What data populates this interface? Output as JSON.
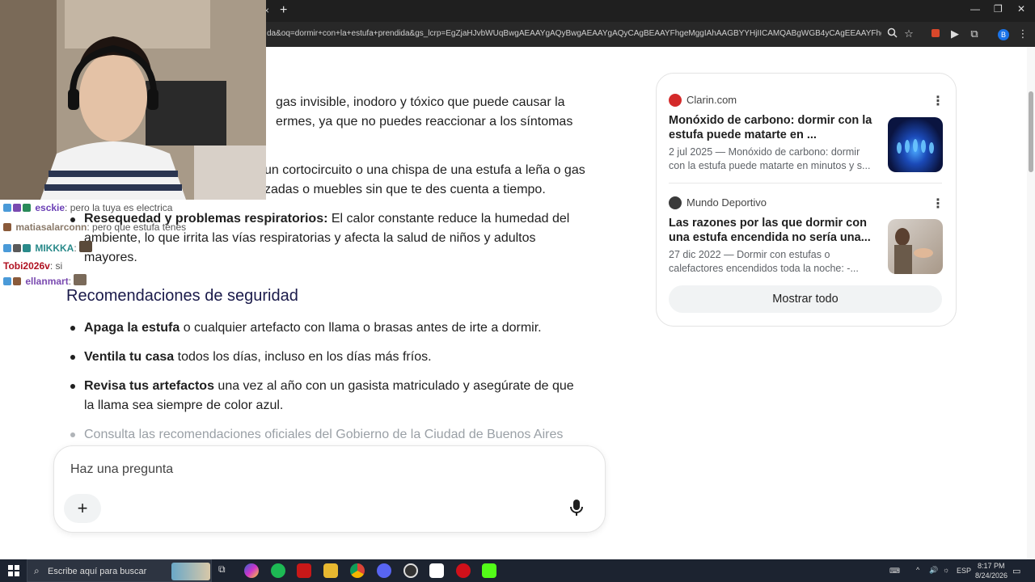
{
  "browser": {
    "url": "da&oq=dormir+con+la+estufa+prendida&gs_lcrp=EgZjaHJvbWUqBwgAEAAYgAQyBwgAEAAYgAQyCAgBEAAYFhgeMggIAhAAGBYYHjIICAMQABgWGB4yCAgEEAAYFhgeMggIBRAAGB...",
    "new_tab": "+",
    "close_tab": "×",
    "window_controls": [
      "—",
      "❐",
      "✕"
    ]
  },
  "content": {
    "para1_line1": "gas invisible, inodoro y tóxico que puede causar la",
    "para1_line2": "ermes, ya que no puedes reaccionar a los síntomas",
    "para2_line1": "un cortocircuito o una chispa de una estufa a leña o gas",
    "para2_line2": "zadas o muebles sin que te des cuenta a tiempo.",
    "bullet3_bold": "Resequedad y problemas respiratorios:",
    "bullet3_text_1": " El calor constante reduce la humedad del",
    "bullet3_text_2": "ambiente, lo que irrita las vías respiratorias y afecta la salud de niños y adultos",
    "bullet3_text_3": "mayores.",
    "section_heading": "Recomendaciones de seguridad",
    "rec1_bold": "Apaga la estufa",
    "rec1_text": " o cualquier artefacto con llama o brasas antes de irte a dormir.",
    "rec2_bold": "Ventila tu casa",
    "rec2_text": " todos los días, incluso en los días más fríos.",
    "rec3_bold": "Revisa tus artefactos",
    "rec3_text_1": " una vez al año con un gasista matriculado y asegúrate de que",
    "rec3_text_2": "la llama sea siempre de color azul.",
    "rec4_text": "Consulta las recomendaciones oficiales del Gobierno de la Ciudad de Buenos Aires"
  },
  "sources": {
    "items": [
      {
        "site": "Clarin.com",
        "title_1": "Monóxido de carbono: dormir con la",
        "title_2": "estufa puede matarte en ...",
        "snippet_1": "2 jul 2025 — Monóxido de carbono: dormir",
        "snippet_2": "con la estufa puede matarte en minutos y s...",
        "thumb": "gas-flame-image"
      },
      {
        "site": "Mundo Deportivo",
        "title_1": "Las razones por las que dormir con",
        "title_2": "una estufa encendida no sería una...",
        "snippet_1": "27 dic 2022 — Dormir con estufas o",
        "snippet_2": "calefactores encendidos toda la noche: -...",
        "thumb": "person-warming-hands-image"
      }
    ],
    "show_all": "Mostrar todo"
  },
  "ask": {
    "placeholder": "Haz una pregunta"
  },
  "chat": {
    "lines": [
      {
        "user": "esckie",
        "msg": ": pero la tuya es electrica"
      },
      {
        "user": "matiasalarconn",
        "msg": ": pero que estufa tenes"
      },
      {
        "user": "MIKKKA",
        "msg": ":"
      },
      {
        "user": "Tobi2026v",
        "msg": ": si"
      },
      {
        "user": "ellanmart",
        "msg": ":"
      }
    ]
  },
  "taskbar": {
    "search_placeholder": "Escribe aquí para buscar",
    "lang": "ESP",
    "time": "8:17 PM",
    "date": "8/24/2026"
  },
  "colors": {
    "accent_link": "#1a1a4a",
    "clarin_red": "#d42a2a",
    "chat_user1": "#6a3fb5",
    "chat_user2": "#8a7a6a",
    "chat_user3": "#2a8a8a",
    "chat_user4": "#b01020",
    "chat_user5": "#7a4ab0"
  }
}
